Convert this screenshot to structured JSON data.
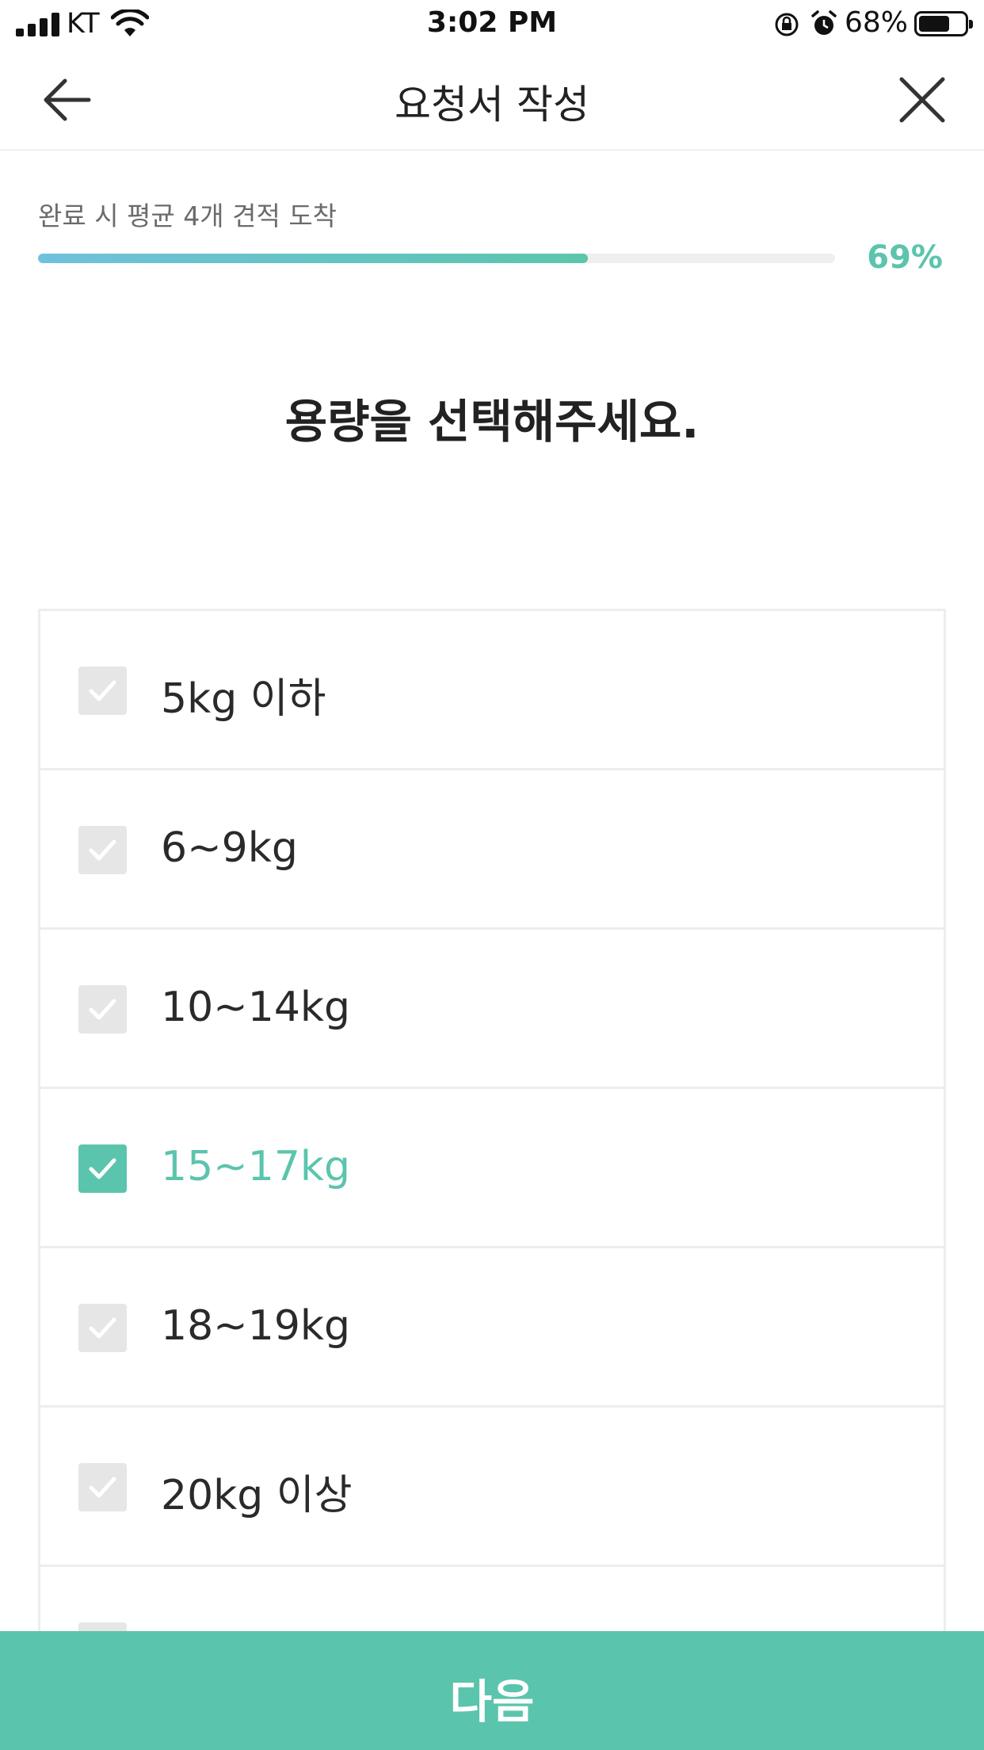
{
  "status_bar": {
    "carrier": "KT",
    "time": "3:02 PM",
    "battery_percent": "68%",
    "battery_level": 0.68,
    "icons": [
      "signal-icon",
      "wifi-icon",
      "rotation-lock-icon",
      "alarm-icon",
      "battery-icon"
    ]
  },
  "header": {
    "title": "요청서 작성",
    "back_icon": "arrow-left-icon",
    "close_icon": "close-icon"
  },
  "progress": {
    "caption": "완료 시 평균 4개 견적 도착",
    "percent_label": "69%",
    "value": 0.69
  },
  "question": "용량을 선택해주세요.",
  "options": [
    {
      "label": "5kg 이하",
      "selected": false
    },
    {
      "label": "6~9kg",
      "selected": false
    },
    {
      "label": "10~14kg",
      "selected": false
    },
    {
      "label": "15~17kg",
      "selected": true
    },
    {
      "label": "18~19kg",
      "selected": false
    },
    {
      "label": "20kg 이상",
      "selected": false
    }
  ],
  "next_button": {
    "label": "다음"
  },
  "colors": {
    "accent": "#5bc4ad",
    "progress_start": "#6fc1dc",
    "unchecked_box": "#e6e6e6",
    "divider": "#ededed"
  }
}
